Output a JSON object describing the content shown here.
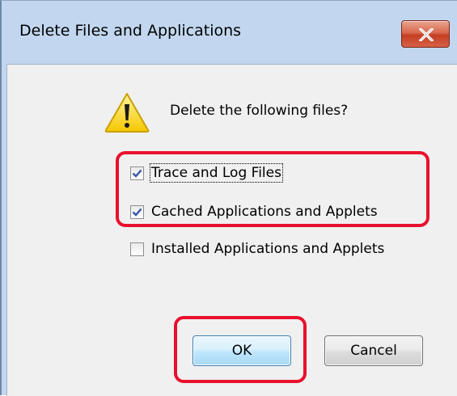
{
  "window": {
    "title": "Delete Files and Applications"
  },
  "dialog": {
    "prompt": "Delete the following files?",
    "options": [
      {
        "label": "Trace and Log Files",
        "checked": true
      },
      {
        "label": "Cached Applications and Applets",
        "checked": true
      },
      {
        "label": "Installed Applications and Applets",
        "checked": false
      }
    ],
    "buttons": {
      "ok_label": "OK",
      "cancel_label": "Cancel"
    }
  },
  "icons": {
    "close": "close-icon",
    "warning": "warning-icon",
    "check": "check-icon"
  },
  "colors": {
    "highlight": "#e8112d",
    "title_bar": "#c2d7ef",
    "client_bg": "#f0f0f0",
    "close_button": "#c43f23",
    "check_mark": "#3557a8"
  }
}
